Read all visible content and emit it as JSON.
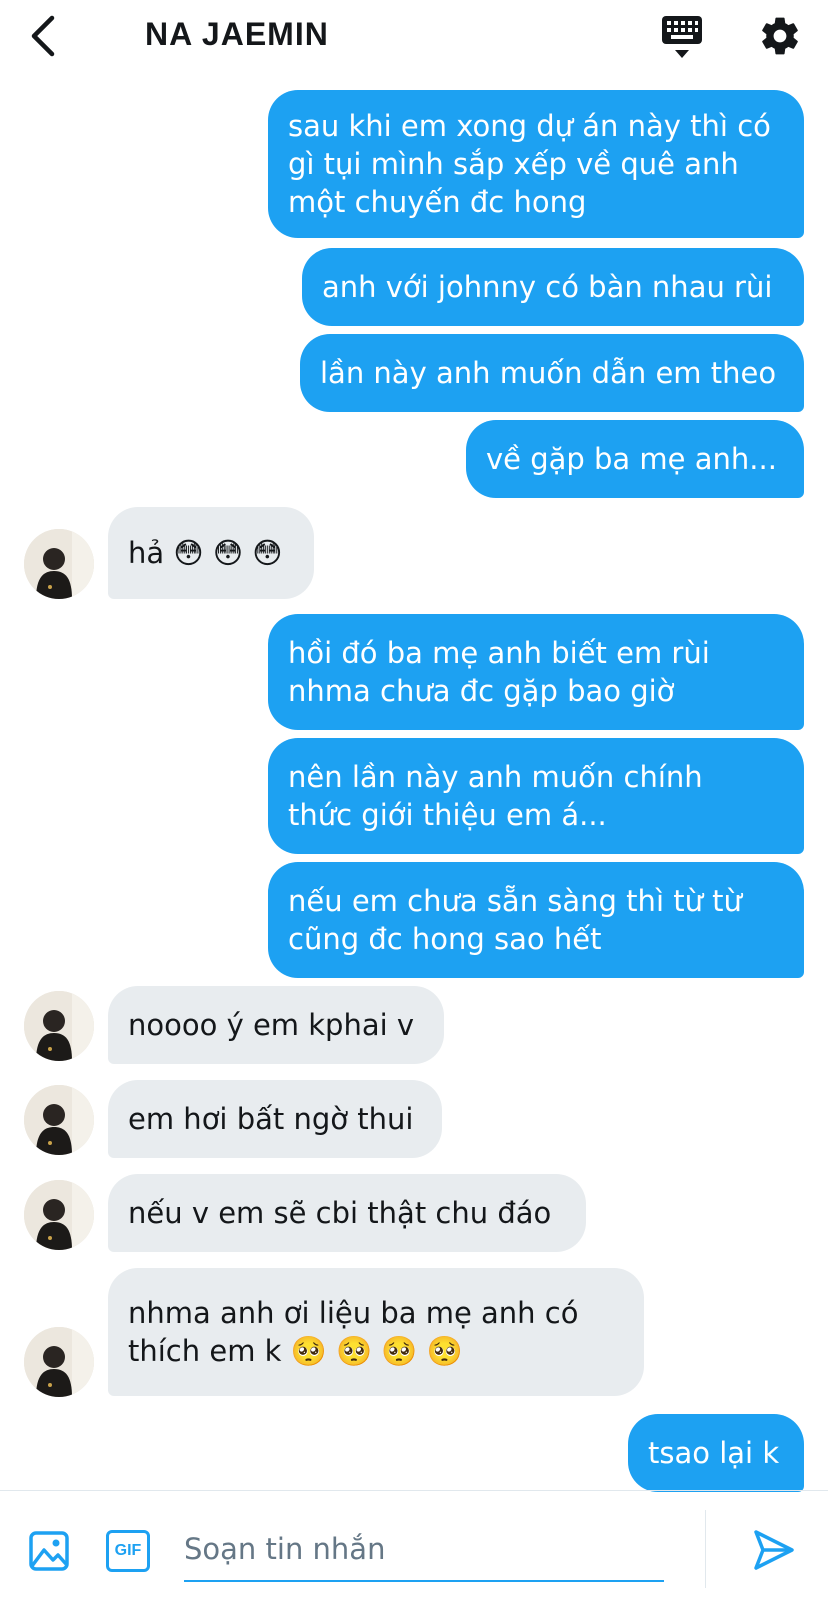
{
  "header": {
    "title": "NA JAEMIN",
    "back_icon": "chevron-left-icon",
    "keyboard_icon": "keyboard-icon",
    "settings_icon": "gear-icon"
  },
  "messages": [
    {
      "dir": "out",
      "lines": [
        "sau khi em xong dự án này thì có",
        "gì tụi mình sắp xếp về quê anh",
        "một chuyến đc hong"
      ]
    },
    {
      "dir": "out",
      "lines": [
        "anh với johnny có bàn nhau rùi"
      ]
    },
    {
      "dir": "out",
      "lines": [
        "lần này anh muốn dẫn em theo"
      ]
    },
    {
      "dir": "out",
      "lines": [
        "về gặp ba mẹ anh..."
      ]
    },
    {
      "dir": "in",
      "lines": [
        "hả 😳 😳 😳"
      ]
    },
    {
      "dir": "out",
      "lines": [
        "hồi đó ba mẹ anh biết em rùi",
        "nhma chưa đc gặp bao giờ"
      ]
    },
    {
      "dir": "out",
      "lines": [
        "nên lần này anh muốn chính",
        "thức giới thiệu em á..."
      ]
    },
    {
      "dir": "out",
      "lines": [
        "nếu em chưa sẵn sàng thì từ từ",
        "cũng đc hong sao hết"
      ]
    },
    {
      "dir": "in",
      "lines": [
        "noooo ý em kphai v"
      ]
    },
    {
      "dir": "in",
      "lines": [
        "em hơi bất ngờ thui"
      ]
    },
    {
      "dir": "in",
      "lines": [
        "nếu v em sẽ cbi thật chu đáo"
      ]
    },
    {
      "dir": "in",
      "lines": [
        "nhma anh ơi liệu ba mẹ anh có",
        "thích em k 🥺 🥺 🥺 🥺"
      ]
    },
    {
      "dir": "out",
      "lines": [
        "tsao lại k"
      ]
    }
  ],
  "composer": {
    "placeholder": "Soạn tin nhắn",
    "value": "",
    "image_icon": "image-icon",
    "gif_label": "GIF",
    "send_icon": "send-icon"
  },
  "colors": {
    "accent": "#1da1f2",
    "incoming_bubble": "#e8ecef",
    "text": "#14171a"
  }
}
